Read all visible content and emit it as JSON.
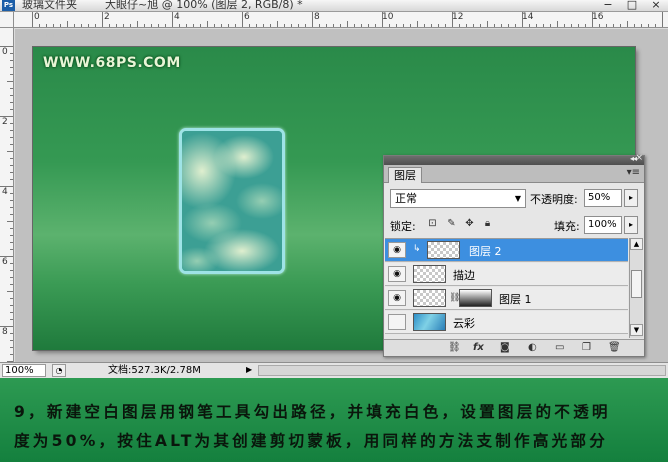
{
  "app": {
    "logo": "Ps",
    "folder_label": "玻璃文件夹",
    "document_title": "大眼仔~旭 @ 100% (图层 2, RGB/8) *"
  },
  "rulers": {
    "top_labels": [
      "0",
      "2",
      "4",
      "6",
      "8",
      "10",
      "12",
      "14",
      "16"
    ],
    "left_labels": [
      "0",
      "2",
      "4",
      "6",
      "8",
      "1"
    ]
  },
  "canvas": {
    "watermark": "WWW.68PS.COM",
    "background_color": "#2f9450",
    "card_border_color": "#9ee3e6"
  },
  "layers_panel": {
    "tab_label": "图层",
    "blend_mode": "正常",
    "opacity_label": "不透明度:",
    "opacity_value": "50%",
    "lock_label": "锁定:",
    "fill_label": "填充:",
    "fill_value": "100%",
    "layers": [
      {
        "name": "图层 2",
        "visible": true,
        "selected": true,
        "clipped": true
      },
      {
        "name": "描边",
        "visible": true,
        "selected": false
      },
      {
        "name": "图层 1",
        "visible": true,
        "selected": false,
        "has_mask": true
      },
      {
        "name": "云彩",
        "visible": false,
        "selected": false
      }
    ],
    "footer_icons": [
      "link-icon",
      "fx-icon",
      "mask-icon",
      "adjustment-icon",
      "group-icon",
      "new-layer-icon",
      "trash-icon"
    ]
  },
  "statusbar": {
    "zoom": "100%",
    "doc_info": "文档:527.3K/2.78M"
  },
  "instruction": {
    "line1": "9，新建空白图层用钢笔工具勾出路径，并填充白色，设置图层的不透明",
    "line2": "度为50%，按住ALT为其创建剪切蒙板，用同样的方法支制作高光部分"
  },
  "colors": {
    "banner": "#1f8c47",
    "selected_layer": "#3d8fe0"
  }
}
